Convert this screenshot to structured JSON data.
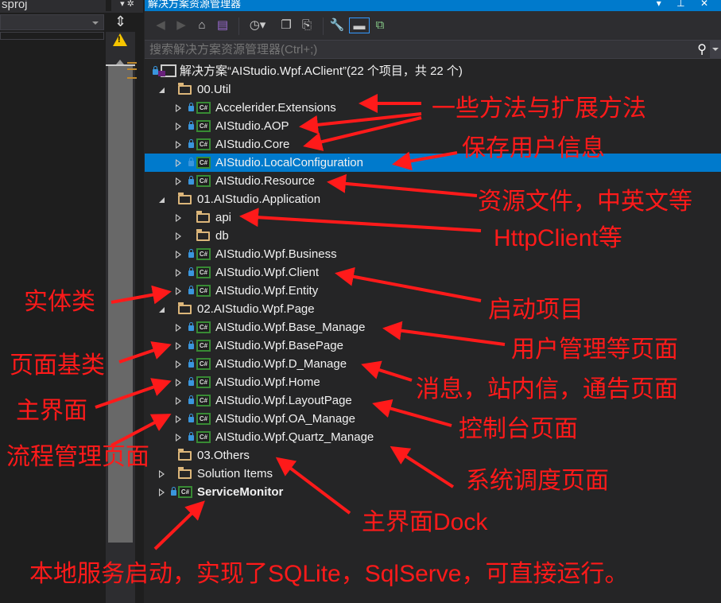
{
  "left_pane": {
    "tab_title": "sproj",
    "pane_icons": "▾ ✲",
    "split_icon": "⇕",
    "warning_glyph": "!"
  },
  "panel": {
    "title": "解决方案资源管理器",
    "title_buttons": "▾ ⊥ ✕",
    "search_placeholder": "搜索解决方案资源管理器(Ctrl+;)",
    "toolbar_icons": [
      "back-icon",
      "forward-icon",
      "home-icon",
      "switch-views-icon",
      "pending-changes-icon",
      "collapse-all-icon",
      "show-all-files-icon",
      "properties-icon",
      "preview-icon",
      "class-diagram-icon"
    ],
    "cs_icon_label": "C#"
  },
  "tree": [
    {
      "label": "解决方案“AIStudio.Wpf.AClient”(22 个项目，共 22 个)",
      "type": "solution",
      "level": 0,
      "exp": "none",
      "lock": true
    },
    {
      "label": "00.Util",
      "type": "folder",
      "level": 1,
      "exp": "o"
    },
    {
      "label": "Accelerider.Extensions",
      "type": "cs",
      "level": 2,
      "exp": "c",
      "lock": true
    },
    {
      "label": "AIStudio.AOP",
      "type": "cs",
      "level": 2,
      "exp": "c",
      "lock": true
    },
    {
      "label": "AIStudio.Core",
      "type": "cs",
      "level": 2,
      "exp": "c",
      "lock": true
    },
    {
      "label": "AIStudio.LocalConfiguration",
      "type": "cs",
      "level": 2,
      "exp": "c",
      "lock": true,
      "selected": true
    },
    {
      "label": "AIStudio.Resource",
      "type": "cs",
      "level": 2,
      "exp": "c",
      "lock": true
    },
    {
      "label": "01.AIStudio.Application",
      "type": "folder",
      "level": 1,
      "exp": "o"
    },
    {
      "label": "api",
      "type": "folder",
      "level": 2,
      "exp": "c"
    },
    {
      "label": "db",
      "type": "folder",
      "level": 2,
      "exp": "c"
    },
    {
      "label": "AIStudio.Wpf.Business",
      "type": "cs",
      "level": 2,
      "exp": "c",
      "lock": true
    },
    {
      "label": "AIStudio.Wpf.Client",
      "type": "cs",
      "level": 2,
      "exp": "c",
      "lock": true
    },
    {
      "label": "AIStudio.Wpf.Entity",
      "type": "cs",
      "level": 2,
      "exp": "c",
      "lock": true
    },
    {
      "label": "02.AIStudio.Wpf.Page",
      "type": "folder",
      "level": 1,
      "exp": "o"
    },
    {
      "label": "AIStudio.Wpf.Base_Manage",
      "type": "cs",
      "level": 2,
      "exp": "c",
      "lock": true
    },
    {
      "label": "AIStudio.Wpf.BasePage",
      "type": "cs",
      "level": 2,
      "exp": "c",
      "lock": true
    },
    {
      "label": "AIStudio.Wpf.D_Manage",
      "type": "cs",
      "level": 2,
      "exp": "c",
      "lock": true
    },
    {
      "label": "AIStudio.Wpf.Home",
      "type": "cs",
      "level": 2,
      "exp": "c",
      "lock": true
    },
    {
      "label": "AIStudio.Wpf.LayoutPage",
      "type": "cs",
      "level": 2,
      "exp": "c",
      "lock": true
    },
    {
      "label": "AIStudio.Wpf.OA_Manage",
      "type": "cs",
      "level": 2,
      "exp": "c",
      "lock": true
    },
    {
      "label": "AIStudio.Wpf.Quartz_Manage",
      "type": "cs",
      "level": 2,
      "exp": "c",
      "lock": true
    },
    {
      "label": "03.Others",
      "type": "folder",
      "level": 1,
      "exp": "none"
    },
    {
      "label": "Solution Items",
      "type": "folder",
      "level": 1,
      "exp": "c"
    },
    {
      "label": "ServiceMonitor",
      "type": "cs",
      "level": 1,
      "exp": "c",
      "lock": true,
      "bold": true
    }
  ],
  "annotations": {
    "extensions": "一些方法与扩展方法",
    "user_info": "保存用户信息",
    "resources": "资源文件，中英文等",
    "httpclient": "HttpClient等",
    "entity": "实体类",
    "startup": "启动项目",
    "user_mgmt": "用户管理等页面",
    "basepage": "页面基类",
    "messages": "消息，站内信，通告页面",
    "home": "主界面",
    "console": "控制台页面",
    "workflow": "流程管理页面",
    "scheduler": "系统调度页面",
    "dock": "主界面Dock",
    "service": "本地服务启动，实现了SQLite，SqlServe，可直接运行。"
  },
  "colors": {
    "accent": "#007acc",
    "annotation": "#ff1a1a",
    "cs_icon": "#388a34",
    "folder": "#dcb67a"
  }
}
